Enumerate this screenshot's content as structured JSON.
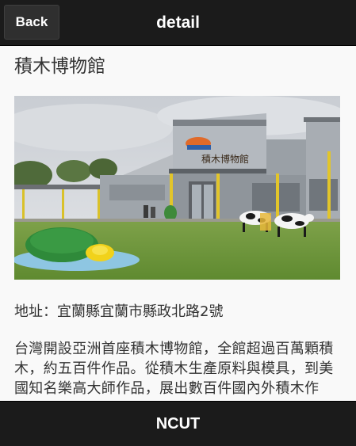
{
  "header": {
    "back_label": "Back",
    "title": "detail"
  },
  "main": {
    "title": "積木博物館",
    "address": "地址：宜蘭縣宜蘭市縣政北路2號",
    "description": "台灣開設亞洲首座積木博物館，全館超過百萬顆積木，約五百件作品。從積木生產原料與模具，到美國知名樂高大師作品，展出數百件國內外積木作品。",
    "photo_sign": "積木博物館"
  },
  "footer": {
    "label": "NCUT"
  }
}
